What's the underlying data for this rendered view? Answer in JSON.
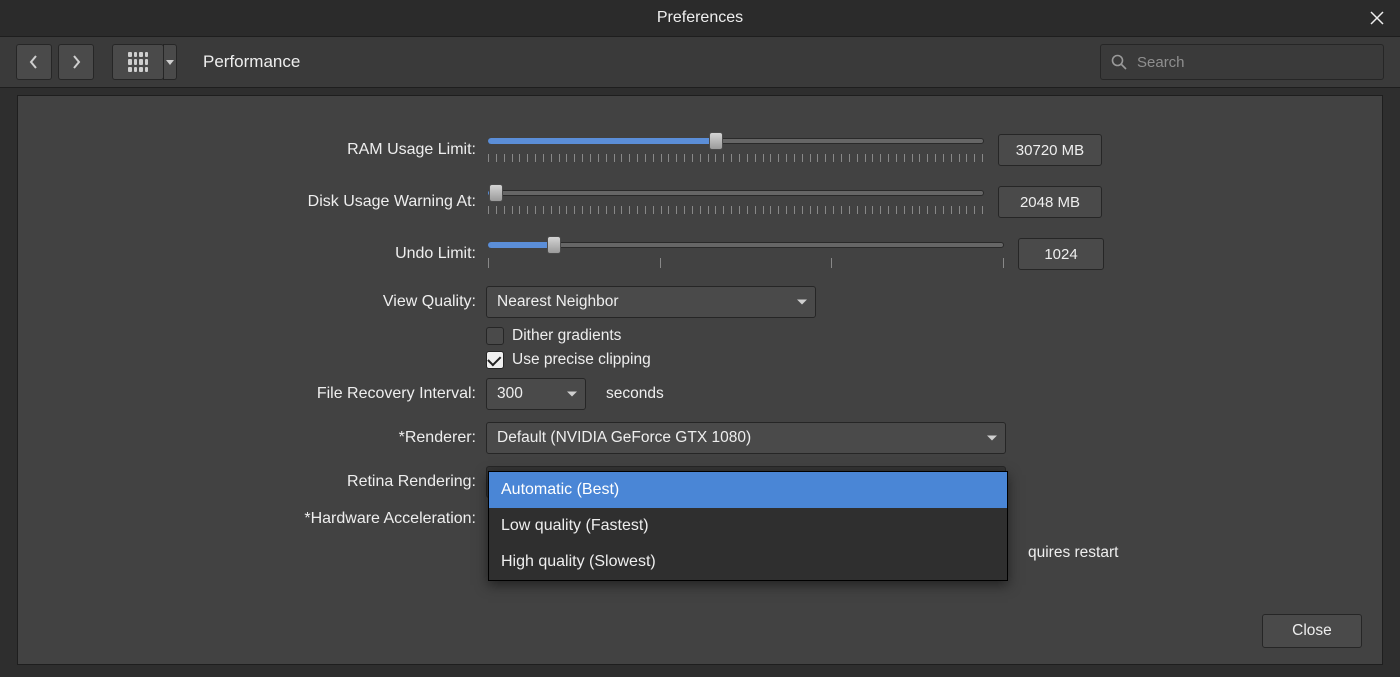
{
  "window": {
    "title": "Preferences"
  },
  "toolbar": {
    "section_title": "Performance",
    "search_placeholder": "Search"
  },
  "form": {
    "ram_label": "RAM Usage Limit:",
    "ram_value": "30720 MB",
    "ram_fill_pct": 46,
    "disk_label": "Disk Usage Warning At:",
    "disk_value": "2048 MB",
    "disk_fill_pct": 2,
    "undo_label": "Undo Limit:",
    "undo_value": "1024",
    "undo_fill_pct": 13,
    "view_quality_label": "View Quality:",
    "view_quality_value": "Nearest Neighbor",
    "dither_label": "Dither gradients",
    "dither_checked": false,
    "clipping_label": "Use precise clipping",
    "clipping_checked": true,
    "recovery_label": "File Recovery Interval:",
    "recovery_value": "300",
    "recovery_suffix": "seconds",
    "renderer_label": "*Renderer:",
    "renderer_value": "Default (NVIDIA GeForce GTX 1080)",
    "retina_label": "Retina Rendering:",
    "retina_value": "Automatic (Best)",
    "retina_options": [
      "Automatic (Best)",
      "Low quality (Fastest)",
      "High quality (Slowest)"
    ],
    "retina_selected_index": 0,
    "hwaccel_label": "*Hardware Acceleration:",
    "restart_note_tail": "quires restart"
  },
  "footer": {
    "close_label": "Close"
  }
}
